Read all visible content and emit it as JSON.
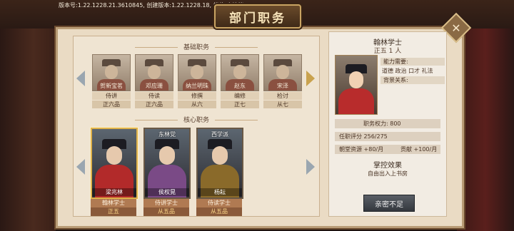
{
  "version": "版本号:1.22.1228.21.3610845, 创建版本:1.22.1228.18, 档位:本地档3",
  "title": "部门职务",
  "close_label": "✕",
  "basic_section": {
    "title": "基础职务",
    "cards": [
      {
        "name": "贺新宝茗",
        "post": "侍讲",
        "rank": "正六品"
      },
      {
        "name": "邓应珊",
        "post": "侍读",
        "rank": "正六品"
      },
      {
        "name": "纳兰明珠",
        "post": "修撰",
        "rank": "从六"
      },
      {
        "name": "赵东",
        "post": "编修",
        "rank": "正七"
      },
      {
        "name": "宋泽",
        "post": "检讨",
        "rank": "从七"
      }
    ]
  },
  "core_section": {
    "title": "核心职务",
    "cards": [
      {
        "name": "梁兆林",
        "badge": "",
        "post": "翰林学士",
        "rank": "正五",
        "robe": "#b22a2a"
      },
      {
        "name": "侯权晃",
        "badge": "东林党",
        "post": "侍讲学士",
        "rank": "从五品",
        "robe": "#7a4a86"
      },
      {
        "name": "杨耘",
        "badge": "西学派",
        "post": "侍读学士",
        "rank": "从五品",
        "robe": "#8a6a2a"
      }
    ]
  },
  "detail": {
    "title": "翰林学士",
    "rank_count": "正五 1 人",
    "ability_label": "能力需要:",
    "abilities": "道德  政治  口才  礼法",
    "background_label": "背景关系:",
    "power": "职务权力:  800",
    "rating": "任职评分  256/275",
    "resource": "朝堂资源 +80/月",
    "contribution": "贡献 +100/月",
    "effect_title": "掌控效果",
    "effect_text": "自由出入上书房",
    "action_button": "亲密不足"
  },
  "colors": {
    "accent_gold": "#c9a24e",
    "panel_bg": "#efe4d2",
    "button_bg": "#34383e"
  },
  "icons": {
    "nav_left": "chevron-left-icon",
    "nav_right": "chevron-right-icon",
    "close": "close-icon"
  }
}
